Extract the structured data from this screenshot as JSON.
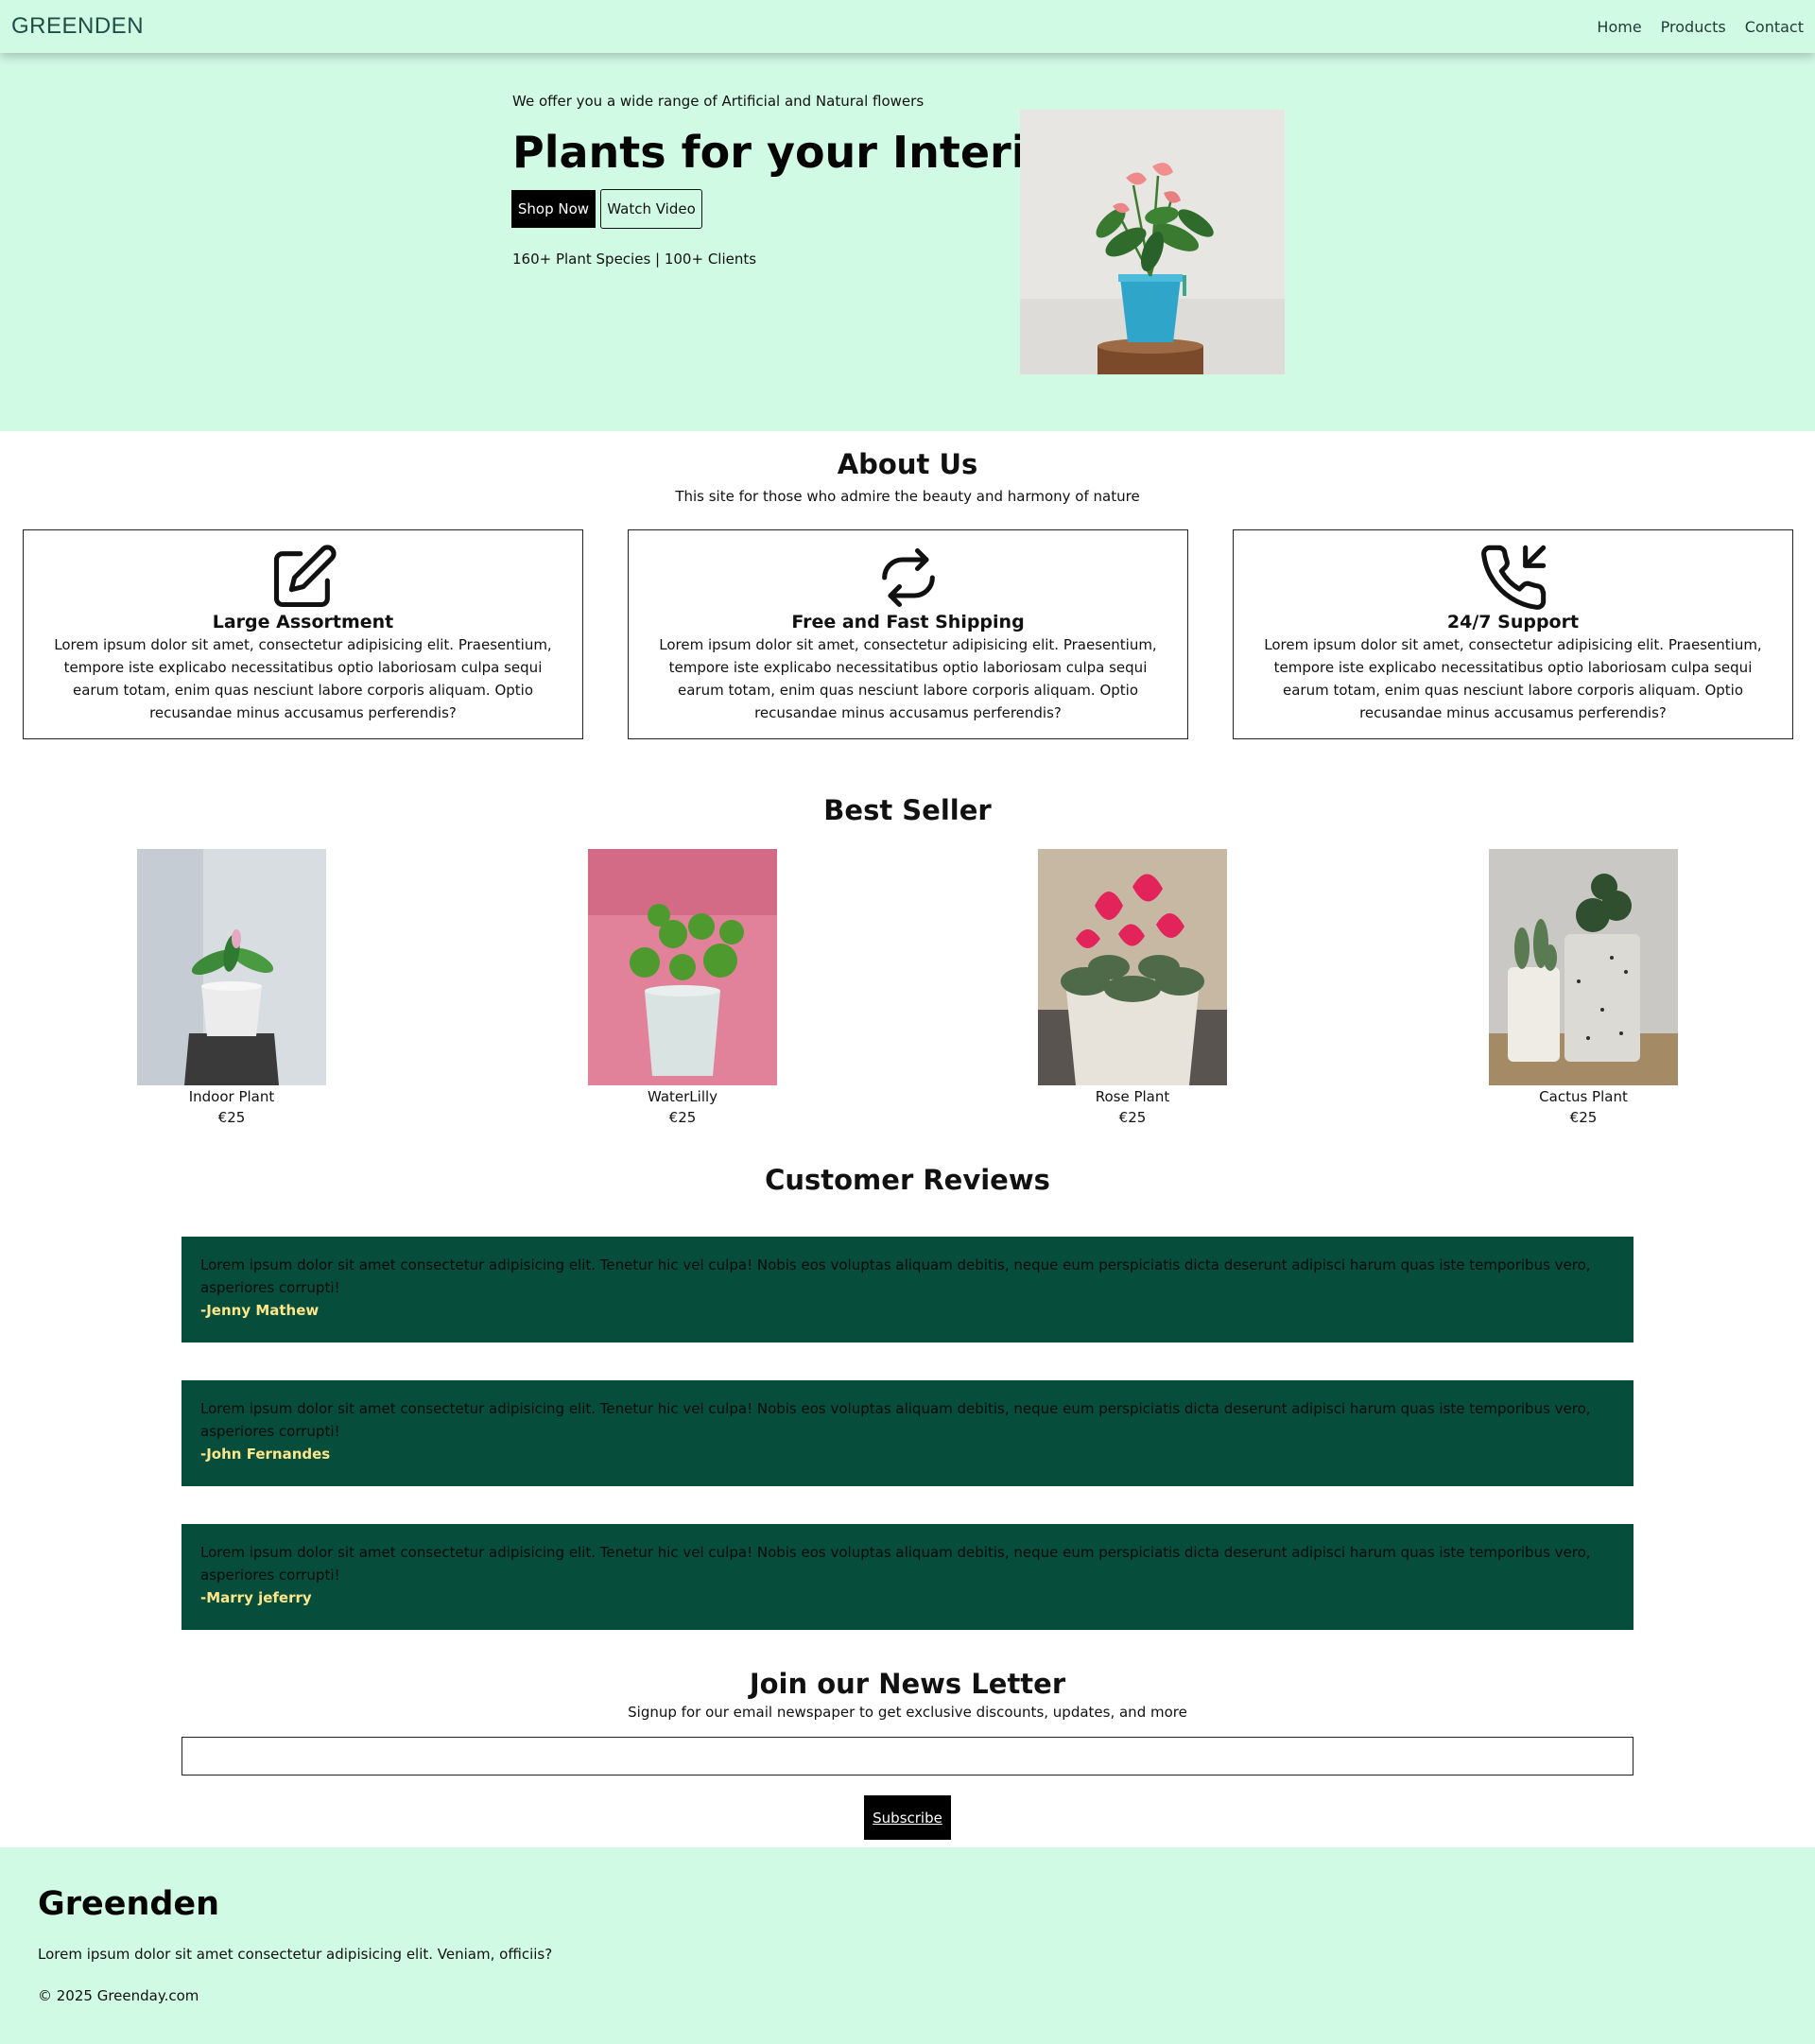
{
  "nav": {
    "brand": "GREENDEN",
    "links": [
      "Home",
      "Products",
      "Contact"
    ]
  },
  "hero": {
    "tagline": "We offer you a wide range of Artificial and Natural flowers",
    "title": "Plants for your Interior",
    "shop_button": "Shop Now",
    "watch_button": "Watch Video",
    "stats": "160+ Plant Species | 100+ Clients"
  },
  "about": {
    "title": "About Us",
    "subtitle": "This site for those who admire the beauty and harmony of nature",
    "features": [
      {
        "icon": "pencil-square-icon",
        "title": "Large Assortment",
        "text": "Lorem ipsum dolor sit amet, consectetur adipisicing elit. Praesentium, tempore iste explicabo necessitatibus optio laboriosam culpa sequi earum totam, enim quas nesciunt labore corporis aliquam. Optio recusandae minus accusamus perferendis?"
      },
      {
        "icon": "refresh-icon",
        "title": "Free and Fast Shipping",
        "text": "Lorem ipsum dolor sit amet, consectetur adipisicing elit. Praesentium, tempore iste explicabo necessitatibus optio laboriosam culpa sequi earum totam, enim quas nesciunt labore corporis aliquam. Optio recusandae minus accusamus perferendis?"
      },
      {
        "icon": "phone-incoming-icon",
        "title": "24/7 Support",
        "text": "Lorem ipsum dolor sit amet, consectetur adipisicing elit. Praesentium, tempore iste explicabo necessitatibus optio laboriosam culpa sequi earum totam, enim quas nesciunt labore corporis aliquam. Optio recusandae minus accusamus perferendis?"
      }
    ]
  },
  "best_seller": {
    "title": "Best Seller",
    "products": [
      {
        "name": "Indoor Plant",
        "price": "€25"
      },
      {
        "name": "WaterLilly",
        "price": "€25"
      },
      {
        "name": "Rose Plant",
        "price": "€25"
      },
      {
        "name": "Cactus Plant",
        "price": "€25"
      }
    ]
  },
  "reviews": {
    "title": "Customer Reviews",
    "items": [
      {
        "text": "Lorem ipsum dolor sit amet consectetur adipisicing elit. Tenetur hic vel culpa! Nobis eos voluptas aliquam debitis, neque eum perspiciatis dicta deserunt adipisci harum quas iste temporibus vero, asperiores corrupti!",
        "author": "-Jenny Mathew"
      },
      {
        "text": "Lorem ipsum dolor sit amet consectetur adipisicing elit. Tenetur hic vel culpa! Nobis eos voluptas aliquam debitis, neque eum perspiciatis dicta deserunt adipisci harum quas iste temporibus vero, asperiores corrupti!",
        "author": "-John Fernandes"
      },
      {
        "text": "Lorem ipsum dolor sit amet consectetur adipisicing elit. Tenetur hic vel culpa! Nobis eos voluptas aliquam debitis, neque eum perspiciatis dicta deserunt adipisci harum quas iste temporibus vero, asperiores corrupti!",
        "author": "-Marry jeferry"
      }
    ]
  },
  "newsletter": {
    "title": "Join our News Letter",
    "subtitle": "Signup for our email newspaper to get exclusive discounts, updates, and more",
    "input_value": "",
    "button": "Subscribe"
  },
  "footer": {
    "brand": "Greenden",
    "text": "Lorem ipsum dolor sit amet consectetur adipisicing elit. Veniam, officiis?",
    "copyright": "© 2025 Greenday.com"
  },
  "colors": {
    "mint_background": "#d1fae5",
    "review_background": "#064e3b",
    "review_author": "#fde68a",
    "brand_text": "#1e4f47"
  }
}
